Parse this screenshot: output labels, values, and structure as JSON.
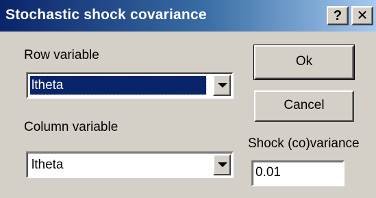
{
  "window": {
    "title": "Stochastic shock covariance",
    "help_button": "?",
    "close_button": "✕"
  },
  "row_variable": {
    "label": "Row variable",
    "selected": "ltheta"
  },
  "column_variable": {
    "label": "Column variable",
    "selected": "ltheta"
  },
  "buttons": {
    "ok": "Ok",
    "cancel": "Cancel"
  },
  "shock": {
    "label": "Shock (co)variance",
    "value": "0.01"
  },
  "colors": {
    "title_gradient_start": "#0a246a",
    "title_gradient_end": "#a6caf0",
    "dialog_face": "#d4d0c8",
    "selection": "#0a246a"
  },
  "icons": {
    "dropdown_arrow": "chevron-down-icon",
    "help": "help-icon",
    "close": "close-icon"
  }
}
